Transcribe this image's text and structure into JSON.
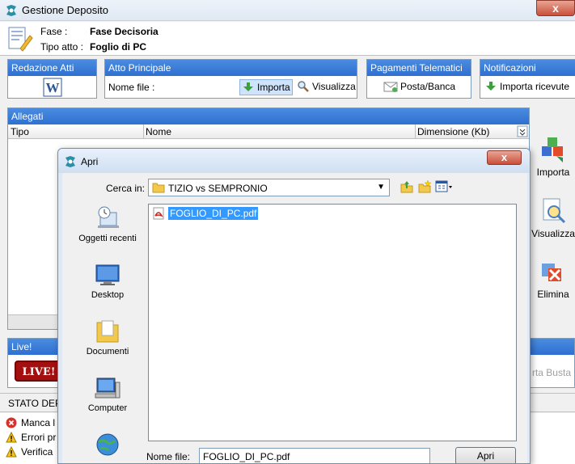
{
  "window": {
    "title": "Gestione Deposito",
    "close_label": "x"
  },
  "info": {
    "fase_label": "Fase :",
    "fase_value": "Fase Decisoria",
    "tipo_label": "Tipo atto :",
    "tipo_value": "Foglio di PC"
  },
  "groups": {
    "redazione": {
      "title": "Redazione Atti"
    },
    "atto_principale": {
      "title": "Atto Principale",
      "nome_file_label": "Nome file :",
      "importa_label": "Importa",
      "visualizza_label": "Visualizza"
    },
    "pagamenti": {
      "title": "Pagamenti Telematici",
      "posta_label": "Posta/Banca"
    },
    "notificazioni": {
      "title": "Notificazioni",
      "importa_ricevute_label": "Importa ricevute"
    }
  },
  "allegati": {
    "title": "Allegati",
    "columns": [
      "Tipo",
      "Nome",
      "Dimensione (Kb)"
    ]
  },
  "side_actions": {
    "importa": "Importa",
    "visualizza": "Visualizza",
    "elimina": "Elimina"
  },
  "live": {
    "title": "Live!",
    "badge": "LIVE!",
    "carta_busta": "rta Busta"
  },
  "stato": {
    "title": "STATO DEP",
    "rows": [
      "Manca l",
      "Errori pr",
      "Verifica"
    ]
  },
  "dialog": {
    "title": "Apri",
    "close_label": "x",
    "lookin_label": "Cerca in:",
    "lookin_value": "TIZIO vs SEMPRONIO",
    "places": [
      "Oggetti recenti",
      "Desktop",
      "Documenti",
      "Computer"
    ],
    "files": [
      "FOGLIO_DI_PC.pdf"
    ],
    "filename_label": "Nome file:",
    "filename_value": "FOGLIO_DI_PC.pdf",
    "open_button": "Apri"
  }
}
